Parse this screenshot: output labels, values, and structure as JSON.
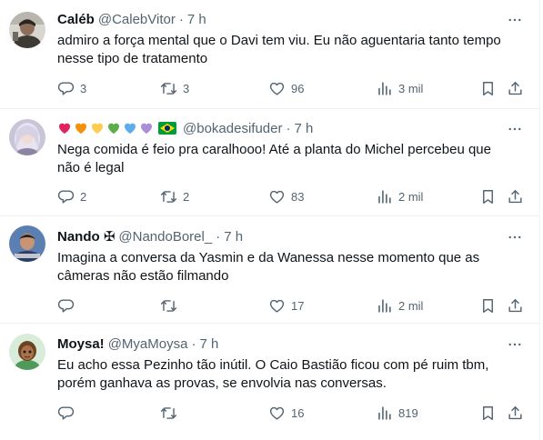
{
  "tweets": [
    {
      "name": "Caléb",
      "handle": "@CalebVitor",
      "separator": "·",
      "time": "7 h",
      "text": "admiro a força mental que o Davi tem viu. Eu não aguentaria tanto tempo nesse tipo de tratamento",
      "replies": "3",
      "retweets": "3",
      "likes": "96",
      "views": "3 mil"
    },
    {
      "name": "",
      "name_emojis": [
        "red-heart",
        "orange-heart",
        "yellow-heart",
        "green-heart",
        "blue-heart",
        "purple-heart",
        "brazil-flag"
      ],
      "emoji_colors": [
        "#e0245e",
        "#f4900c",
        "#ffcc4d",
        "#5dae4a",
        "#5dadec",
        "#aa8ed6"
      ],
      "handle": "@bokadesifuder",
      "separator": "·",
      "time": "7 h",
      "text": "Nega comida é feio pra caralhooo! Até a planta do Michel percebeu que não é legal",
      "replies": "2",
      "retweets": "2",
      "likes": "83",
      "views": "2 mil"
    },
    {
      "name": "Nando ✠",
      "handle": "@NandoBorel_",
      "separator": "·",
      "time": "7 h",
      "text": "Imagina a conversa da Yasmin e da Wanessa nesse momento que as câmeras não estão filmando",
      "replies": "",
      "retweets": "",
      "likes": "17",
      "views": "2 mil"
    },
    {
      "name": "Moysa!",
      "handle": "@MyaMoysa",
      "separator": "·",
      "time": "7 h",
      "text": "Eu acho essa Pezinho tão inútil. O Caio Bastião ficou com pé ruim tbm, porém ganhava as provas, se envolvia nas conversas.",
      "replies": "",
      "retweets": "",
      "likes": "16",
      "views": "819"
    }
  ],
  "icons": {
    "reply": "reply-icon",
    "retweet": "retweet-icon",
    "like": "heart-icon",
    "views": "views-icon",
    "bookmark": "bookmark-icon",
    "share": "share-icon",
    "more": "more-icon"
  },
  "colors": {
    "text": "#0f1419",
    "secondary": "#536471",
    "divider": "#eff3f4"
  }
}
